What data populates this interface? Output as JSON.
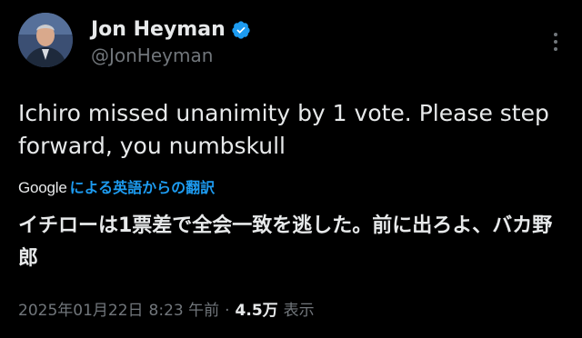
{
  "author": {
    "name": "Jon Heyman",
    "handle": "@JonHeyman"
  },
  "tweet": {
    "text": "Ichiro missed unanimity by 1 vote. Please step forward, you numbskull"
  },
  "translation": {
    "provider": "Google",
    "link_label": "による英語からの翻訳",
    "text": "イチローは1票差で全会一致を逃した。前に出ろよ、バカ野郎"
  },
  "meta": {
    "date": "2025年01月22日",
    "time": "8:23 午前",
    "separator": "·",
    "views": "4.5万",
    "views_label": "表示"
  },
  "colors": {
    "background": "#000000",
    "text": "#e7e9ea",
    "secondary": "#71767b",
    "accent": "#1d9bf0"
  },
  "icons": {
    "verified": "verified-badge-icon",
    "more": "more-options-icon"
  }
}
